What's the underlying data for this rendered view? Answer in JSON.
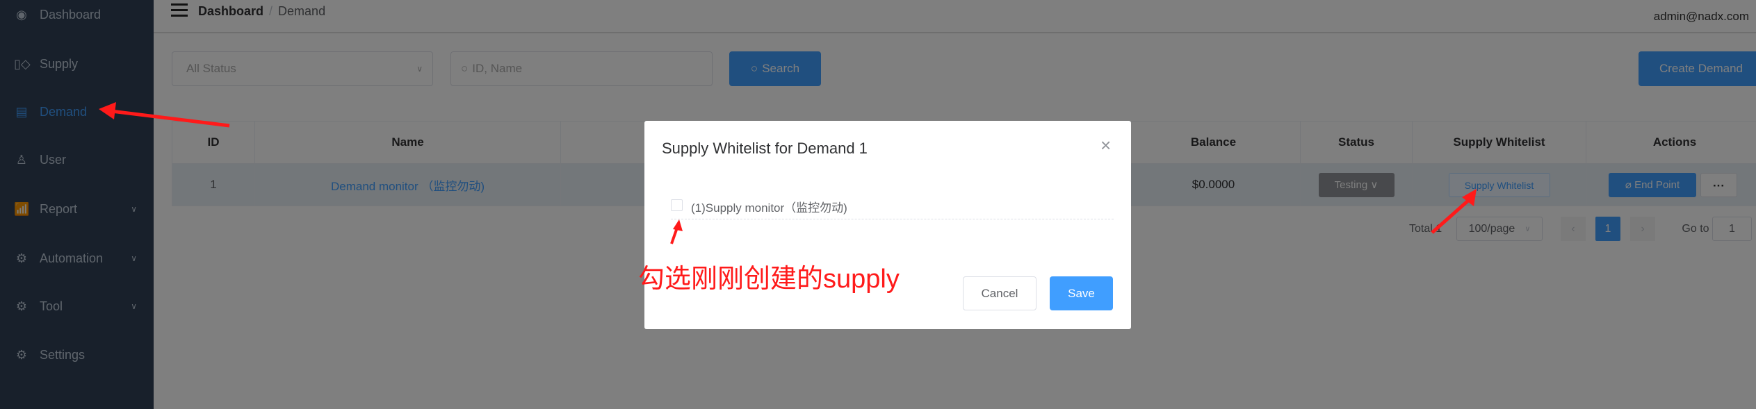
{
  "sidebar": {
    "items": [
      {
        "label": "Dashboard",
        "icon": "dashboard-icon"
      },
      {
        "label": "Supply",
        "icon": "supply-icon"
      },
      {
        "label": "Demand",
        "icon": "demand-icon",
        "active": true
      },
      {
        "label": "User",
        "icon": "user-icon"
      },
      {
        "label": "Report",
        "icon": "report-icon",
        "expandable": true
      },
      {
        "label": "Automation",
        "icon": "gear-icon",
        "expandable": true
      },
      {
        "label": "Tool",
        "icon": "gear-icon",
        "expandable": true
      },
      {
        "label": "Settings",
        "icon": "gear-icon"
      }
    ]
  },
  "header": {
    "breadcrumb": [
      "Dashboard",
      "Demand"
    ],
    "separator": "/",
    "user": "admin@nadx.com"
  },
  "filters": {
    "status_placeholder": "All Status",
    "search_placeholder": "ID, Name",
    "search_label": "Search",
    "create_label": "Create Demand"
  },
  "table": {
    "headers": {
      "id": "ID",
      "name": "Name",
      "balance": "Balance",
      "status": "Status",
      "whitelist": "Supply Whitelist",
      "actions": "Actions"
    },
    "rows": [
      {
        "id": "1",
        "name": "Demand monitor （监控勿动)",
        "balance": "$0.0000",
        "status": "Testing",
        "whitelist": "Supply Whitelist",
        "endpoint": "End Point",
        "more": "···"
      }
    ]
  },
  "pagination": {
    "total": "Total 1",
    "page_size": "100/page",
    "current": "1",
    "prev": "‹",
    "next": "›",
    "goto_label": "Go to",
    "goto_value": "1"
  },
  "modal": {
    "title": "Supply Whitelist for Demand 1",
    "close": "×",
    "options": [
      {
        "label": "(1)Supply monitor（监控勿动)",
        "checked": false
      }
    ],
    "cancel": "Cancel",
    "save": "Save"
  },
  "annotation": {
    "text": "勾选刚刚创建的supply",
    "color": "#ff1a1a"
  },
  "colors": {
    "accent": "#409eff",
    "sidebar": "#304156"
  }
}
